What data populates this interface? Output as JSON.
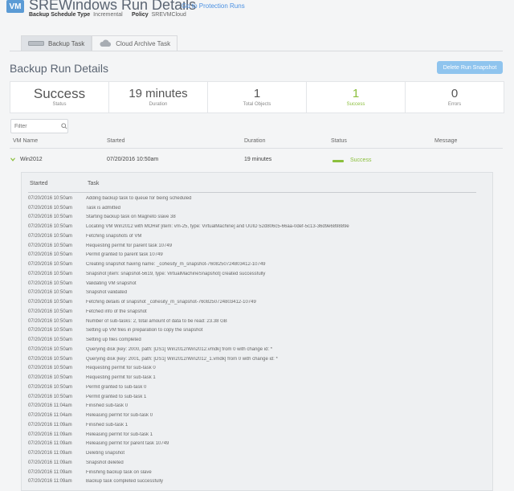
{
  "header": {
    "badge": "VM",
    "title": "SREWindows Run Details",
    "goto_link": "Go to Protection Runs",
    "schedule_label": "Backup Schedule Type",
    "schedule_value": "Incremental",
    "policy_label": "Policy",
    "policy_value": "SREVMCloud"
  },
  "tabs": [
    {
      "label": "Backup Task",
      "icon": "drive-icon"
    },
    {
      "label": "Cloud Archive Task",
      "icon": "cloud-icon"
    }
  ],
  "section": {
    "title": "Backup Run Details",
    "delete_button": "Delete Run Snapshot"
  },
  "summary": [
    {
      "value": "Success",
      "label": "Status"
    },
    {
      "value": "19 minutes",
      "label": "Duration"
    },
    {
      "value": "1",
      "label": "Total Objects"
    },
    {
      "value": "1",
      "label": "Success"
    },
    {
      "value": "0",
      "label": "Errors"
    }
  ],
  "filter": {
    "placeholder": "Filter"
  },
  "table": {
    "headers": {
      "vm_name": "VM Name",
      "started": "Started",
      "duration": "Duration",
      "status": "Status",
      "message": "Message"
    },
    "row": {
      "vm_name": "Win2012",
      "started": "07/20/2016 10:50am",
      "duration": "19 minutes",
      "status": "Success",
      "message": ""
    }
  },
  "tasks": {
    "headers": {
      "started": "Started",
      "task": "Task"
    },
    "rows": [
      {
        "started": "07/20/2016 10:50am",
        "task": "Adding backup task to queue for being scheduled"
      },
      {
        "started": "07/20/2016 10:50am",
        "task": "Task is admitted"
      },
      {
        "started": "07/20/2016 10:50am",
        "task": "Starting backup task on Magneto slave 38"
      },
      {
        "started": "07/20/2016 10:50am",
        "task": "Locating VM Win2012 with MORef [item: vm-25, type: VirtualMachine] and UUID 52d806c5-66aa-0def-5c13-36d9e689889e"
      },
      {
        "started": "07/20/2016 10:50am",
        "task": "Fetching snapshots of VM"
      },
      {
        "started": "07/20/2016 10:50am",
        "task": "Requesting permit for parent task 10749"
      },
      {
        "started": "07/20/2016 10:50am",
        "task": "Permit granted to parent task 10749"
      },
      {
        "started": "07/20/2016 10:50am",
        "task": "Creating snapshot having name: _cohesity_m_snapshot-7608250724803412-10749"
      },
      {
        "started": "07/20/2016 10:50am",
        "task": "Snapshot [item: snapshot-5619, type: VirtualMachineSnapshot] created successfully"
      },
      {
        "started": "07/20/2016 10:50am",
        "task": "Validating VM snapshot"
      },
      {
        "started": "07/20/2016 10:50am",
        "task": "Snapshot validated"
      },
      {
        "started": "07/20/2016 10:50am",
        "task": "Fetching details of snapshot _cohesity_m_snapshot-7608250724803412-10749"
      },
      {
        "started": "07/20/2016 10:50am",
        "task": "Fetched info of the snapshot"
      },
      {
        "started": "07/20/2016 10:50am",
        "task": "Number of sub-tasks: 2, total amount of data to be read: 23.38 GB"
      },
      {
        "started": "07/20/2016 10:50am",
        "task": "Setting up VM files in preparation to copy the snapshot"
      },
      {
        "started": "07/20/2016 10:50am",
        "task": "Setting up files completed"
      },
      {
        "started": "07/20/2016 10:50am",
        "task": "Querying disk [key: 2000, path: [DS1] Win2012/Win2012.vmdk] from 0 with change id: *"
      },
      {
        "started": "07/20/2016 10:50am",
        "task": "Querying disk [key: 2001, path: [DS1] Win2012/Win2012_1.vmdk] from 0 with change id: *"
      },
      {
        "started": "07/20/2016 10:50am",
        "task": "Requesting permit for sub-task 0"
      },
      {
        "started": "07/20/2016 10:50am",
        "task": "Requesting permit for sub-task 1"
      },
      {
        "started": "07/20/2016 10:50am",
        "task": "Permit granted to sub-task 0"
      },
      {
        "started": "07/20/2016 10:50am",
        "task": "Permit granted to sub-task 1"
      },
      {
        "started": "07/20/2016 11:04am",
        "task": "Finished sub-task 0"
      },
      {
        "started": "07/20/2016 11:04am",
        "task": "Releasing permit for sub-task 0"
      },
      {
        "started": "07/20/2016 11:09am",
        "task": "Finished sub-task 1"
      },
      {
        "started": "07/20/2016 11:09am",
        "task": "Releasing permit for sub-task 1"
      },
      {
        "started": "07/20/2016 11:09am",
        "task": "Releasing permit for parent task 10749"
      },
      {
        "started": "07/20/2016 11:09am",
        "task": "Deleting snapshot"
      },
      {
        "started": "07/20/2016 11:09am",
        "task": "Snapshot deleted"
      },
      {
        "started": "07/20/2016 11:09am",
        "task": "Finishing backup task on slave"
      },
      {
        "started": "07/20/2016 11:09am",
        "task": "Backup task completed successfully"
      }
    ]
  },
  "colors": {
    "accent": "#4a90e2",
    "success": "#8bbf3c",
    "badge": "#5b9bd5",
    "button": "#8fc4ee"
  }
}
